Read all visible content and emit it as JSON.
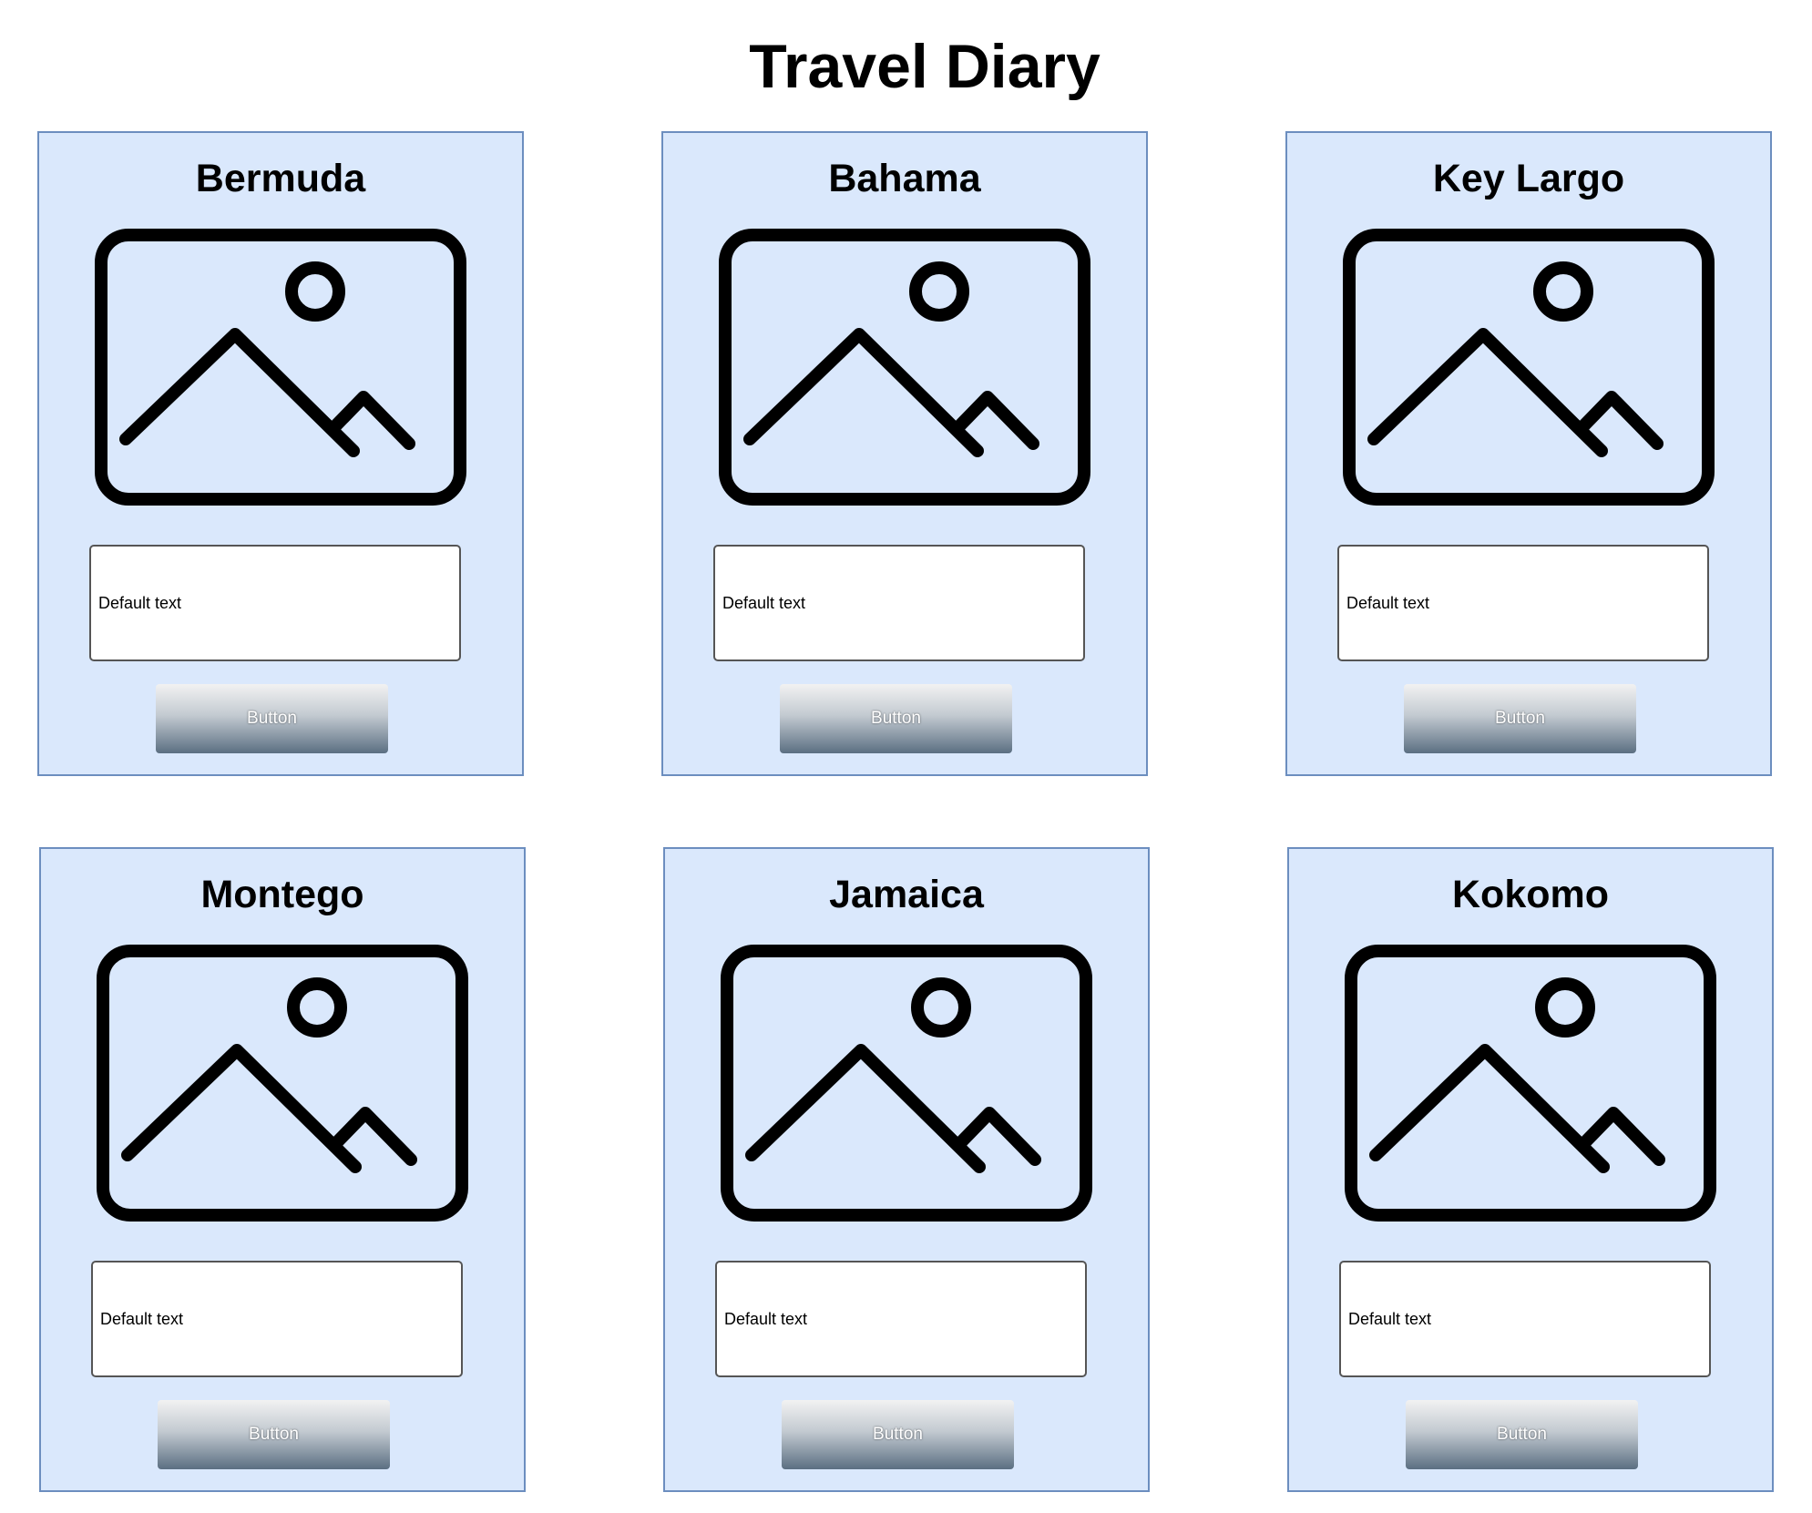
{
  "page": {
    "title": "Travel Diary"
  },
  "colors": {
    "card_fill": "#dae8fc",
    "card_border": "#6c8ebf",
    "button_top": "#f2f2f2",
    "button_bottom": "#5b6f82"
  },
  "cards": [
    {
      "title": "Bermuda",
      "image_icon": "image-placeholder-icon",
      "textbox": "Default text",
      "button": "Button"
    },
    {
      "title": "Bahama",
      "image_icon": "image-placeholder-icon",
      "textbox": "Default text",
      "button": "Button"
    },
    {
      "title": "Key Largo",
      "image_icon": "image-placeholder-icon",
      "textbox": "Default text",
      "button": "Button"
    },
    {
      "title": "Montego",
      "image_icon": "image-placeholder-icon",
      "textbox": "Default text",
      "button": "Button"
    },
    {
      "title": "Jamaica",
      "image_icon": "image-placeholder-icon",
      "textbox": "Default text",
      "button": "Button"
    },
    {
      "title": "Kokomo",
      "image_icon": "image-placeholder-icon",
      "textbox": "Default text",
      "button": "Button"
    }
  ]
}
